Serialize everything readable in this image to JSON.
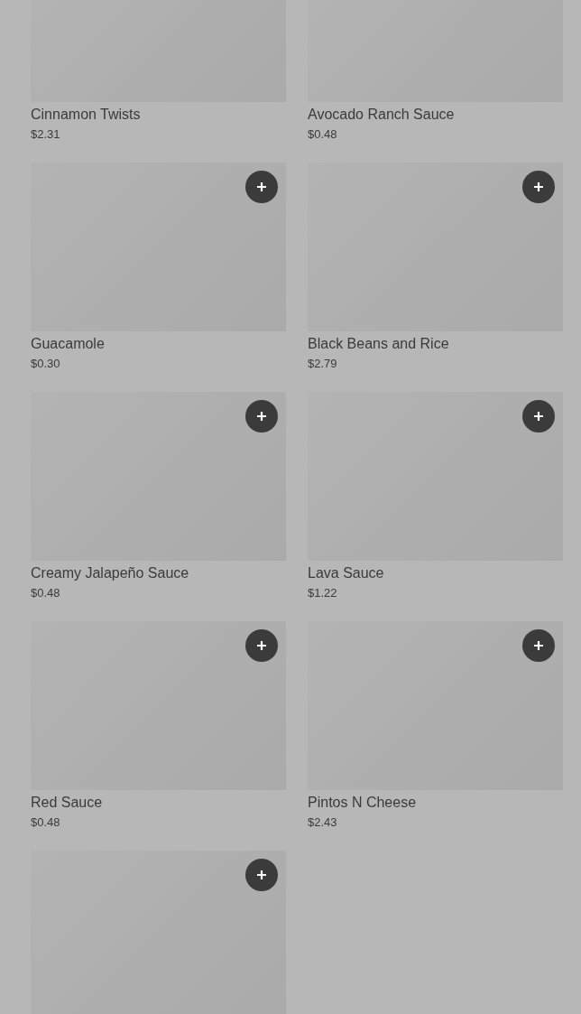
{
  "items": [
    {
      "name": "Cinnamon Twists",
      "price": "$2.31",
      "add_button": false
    },
    {
      "name": "Avocado Ranch Sauce",
      "price": "$0.48",
      "add_button": false
    },
    {
      "name": "Guacamole",
      "price": "$0.30",
      "add_button": true
    },
    {
      "name": "Black Beans and Rice",
      "price": "$2.79",
      "add_button": true
    },
    {
      "name": "Creamy Jalapeño Sauce",
      "price": "$0.48",
      "add_button": true
    },
    {
      "name": "Lava Sauce",
      "price": "$1.22",
      "add_button": true
    },
    {
      "name": "Red Sauce",
      "price": "$0.48",
      "add_button": true
    },
    {
      "name": "Pintos N Cheese",
      "price": "$2.43",
      "add_button": true
    },
    {
      "add_button": true
    }
  ]
}
